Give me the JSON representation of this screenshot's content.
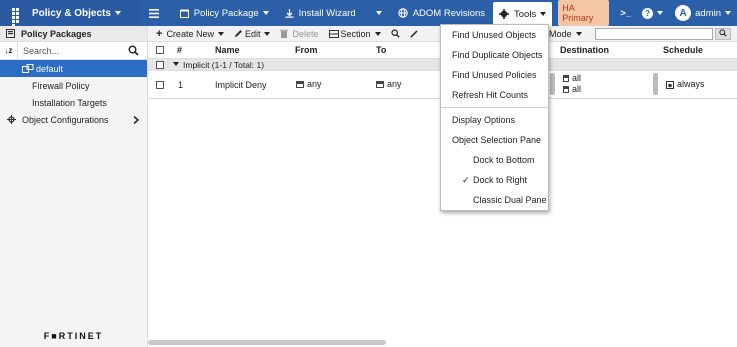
{
  "topbar": {
    "app_title": "Policy & Objects",
    "menu": [
      {
        "label": "Policy Package",
        "has_caret": true
      },
      {
        "label": "Install Wizard",
        "has_caret": false
      }
    ],
    "adom_label": "ADOM Revisions",
    "tools_label": "Tools",
    "ha_badge": "HA Primary",
    "user": "admin",
    "avatar_letter": "A",
    "terminal_glyph": ">_",
    "help_glyph": "?"
  },
  "sidebar": {
    "header": "Policy Packages",
    "search_placeholder": "Search...",
    "sort_glyph": "↓z",
    "items": [
      {
        "label": "default",
        "active": true
      },
      {
        "label": "Firewall Policy"
      },
      {
        "label": "Installation Targets"
      }
    ],
    "object_config": "Object Configurations",
    "logo": "F■RTINET"
  },
  "toolbar": {
    "create_new": "Create New",
    "edit": "Edit",
    "delete": "Delete",
    "section": "Section",
    "view_mode": "w Mode"
  },
  "table": {
    "headers": {
      "num": "#",
      "name": "Name",
      "from": "From",
      "to": "To",
      "destination": "Destination",
      "schedule": "Schedule"
    },
    "section": "Implicit (1-1 / Total: 1)",
    "rows": [
      {
        "num": "1",
        "name": "Implicit Deny",
        "from": "any",
        "to": "any",
        "destination": [
          "all",
          "all"
        ],
        "schedule": "always"
      }
    ]
  },
  "tools_menu": {
    "items": [
      {
        "label": "Find Unused Objects"
      },
      {
        "label": "Find Duplicate Objects"
      },
      {
        "label": "Find Unused Policies"
      },
      {
        "label": "Refresh Hit Counts"
      }
    ],
    "items2": [
      {
        "label": "Display Options"
      },
      {
        "label": "Object Selection Pane"
      }
    ],
    "dock_options": [
      {
        "label": "Dock to Bottom",
        "checked": false
      },
      {
        "label": "Dock to Right",
        "checked": true
      },
      {
        "label": "Classic Dual Pane",
        "checked": false
      }
    ]
  },
  "colors": {
    "topbar": "#2b5fa8",
    "active": "#2b6cc4",
    "ha_badge_bg": "#f5c6a6"
  }
}
